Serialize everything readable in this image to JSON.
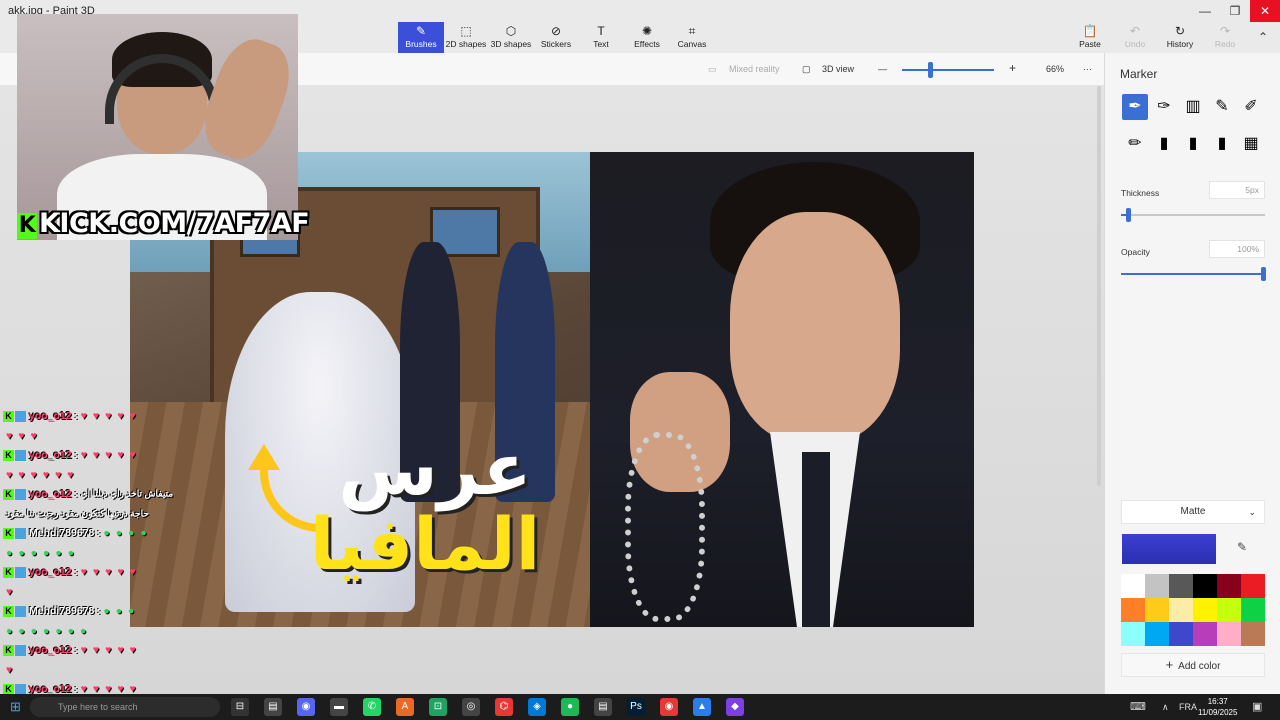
{
  "window": {
    "title": "akk.jpg - Paint 3D",
    "min": "—",
    "restore": "❐",
    "close": "✕"
  },
  "ribbon": {
    "tools": [
      {
        "label": "Brushes",
        "icon": "✎"
      },
      {
        "label": "2D shapes",
        "icon": "⬚"
      },
      {
        "label": "3D shapes",
        "icon": "⬡"
      },
      {
        "label": "Stickers",
        "icon": "⊘"
      },
      {
        "label": "Text",
        "icon": "T"
      },
      {
        "label": "Effects",
        "icon": "✺"
      },
      {
        "label": "Canvas",
        "icon": "⌗"
      }
    ],
    "right": [
      {
        "label": "Paste",
        "icon": "📋"
      },
      {
        "label": "Undo",
        "icon": "↶"
      },
      {
        "label": "History",
        "icon": "↻"
      },
      {
        "label": "Redo",
        "icon": "↷"
      }
    ],
    "collapse": "⌃"
  },
  "viewbar": {
    "mixed_reality": "Mixed reality",
    "view3d": "3D view",
    "zoom_minus": "—",
    "zoom_plus": "+",
    "zoom_level": "66%",
    "more": "···"
  },
  "thumbnail": {
    "title_line1": "عرس",
    "title_line2": "المافيا"
  },
  "webcam": {
    "kick_handle": "KICK.COM/7AF7AF",
    "kick_logo": "K"
  },
  "chat": {
    "badge": "K",
    "rows": [
      {
        "user": "yoo_o12",
        "colon": ":",
        "emotes": "♥♥♥♥♥",
        "color": "#ff3d6b"
      },
      {
        "user": "",
        "colon": "",
        "emotes": "♥♥♥",
        "color": "#ff3d6b"
      },
      {
        "user": "yoo_o12",
        "colon": ":",
        "emotes": "♥♥♥♥♥",
        "color": "#ff3d6b"
      },
      {
        "user": "",
        "colon": "",
        "emotes": "♥♥♥♥♥♥",
        "color": "#ff3d6b"
      },
      {
        "user": "yoo_o12",
        "colon": ":",
        "msg": "متيفاش تاخد راي دبلنا اي",
        "color": "#ff3d6b"
      },
      {
        "user": "",
        "colon": "",
        "msg": "حاجة درتيها كتكون مقود رجيت ننا مقود",
        "color": "#ff3d6b"
      },
      {
        "user": "Mehdi789678",
        "colon": ":",
        "emotes": "●●●●",
        "color": "#ffffff"
      },
      {
        "user": "",
        "colon": "",
        "emotes": "●●●●●●",
        "color": "#ffffff"
      },
      {
        "user": "yoo_o12",
        "colon": ":",
        "emotes": "♥♥♥♥♥",
        "color": "#ff3d6b"
      },
      {
        "user": "",
        "colon": "",
        "emotes": "♥",
        "color": "#ff3d6b"
      },
      {
        "user": "Mehdi789678",
        "colon": ":",
        "emotes": "●●●",
        "color": "#ffffff"
      },
      {
        "user": "",
        "colon": "",
        "emotes": "●●●●●●●",
        "color": "#ffffff"
      },
      {
        "user": "yoo_o12",
        "colon": ":",
        "emotes": "♥♥♥♥♥",
        "color": "#ff3d6b"
      },
      {
        "user": "",
        "colon": "",
        "emotes": "♥",
        "color": "#ff3d6b"
      },
      {
        "user": "yoo_o12",
        "colon": ":",
        "emotes": "♥♥♥♥♥",
        "color": "#ff3d6b"
      }
    ]
  },
  "panel": {
    "title": "Marker",
    "thickness_label": "Thickness",
    "thickness_value": "5px",
    "thickness_level": 0.05,
    "opacity_label": "Opacity",
    "opacity_value": "100%",
    "opacity_level": 1.0,
    "finish": "Matte",
    "finish_chevron": "⌄",
    "current_color": "#3c3fd0",
    "eyedropper": "✎",
    "add_color": "Add color",
    "add_icon": "+",
    "brushes": [
      "✒",
      "✑",
      "▥",
      "✎",
      "✐",
      "✏",
      "▮",
      "▮",
      "▮",
      "▦"
    ],
    "palette": [
      "#ffffff",
      "#c3c3c3",
      "#585858",
      "#000000",
      "#88001b",
      "#ec1c24",
      "#ff7f27",
      "#ffca18",
      "#fdeca6",
      "#fff200",
      "#c4ff0e",
      "#0ed145",
      "#8cfffb",
      "#00a8f3",
      "#3f48cc",
      "#b83dba",
      "#ffaec8",
      "#b97a56"
    ]
  },
  "taskbar": {
    "start": "⊞",
    "search_placeholder": "Type here to search",
    "apps": [
      "⊟",
      "▤",
      "◉",
      "▬",
      "✆",
      "A",
      "⊡",
      "◎",
      "⌬",
      "◈",
      "●",
      "▤",
      "Ps",
      "◉",
      "▲",
      "◆"
    ],
    "lang": "FRA",
    "time": "16:37",
    "date": "11/09/2025",
    "chevron": "∧",
    "notify": "▣"
  }
}
